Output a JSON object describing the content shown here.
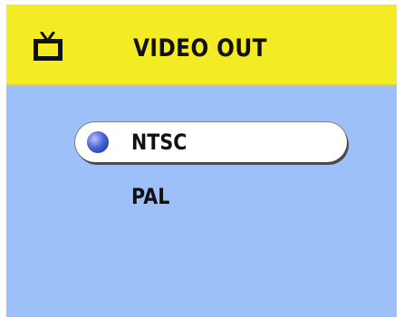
{
  "header": {
    "icon": "tv-icon",
    "title": "VIDEO OUT"
  },
  "options": {
    "items": [
      {
        "label": "NTSC",
        "selected": true
      },
      {
        "label": "PAL",
        "selected": false
      }
    ]
  },
  "colors": {
    "header_background": "#f3ec24",
    "screen_background": "#9cc0f7",
    "selection_background": "#ffffff",
    "bullet": "#3a52c8"
  }
}
